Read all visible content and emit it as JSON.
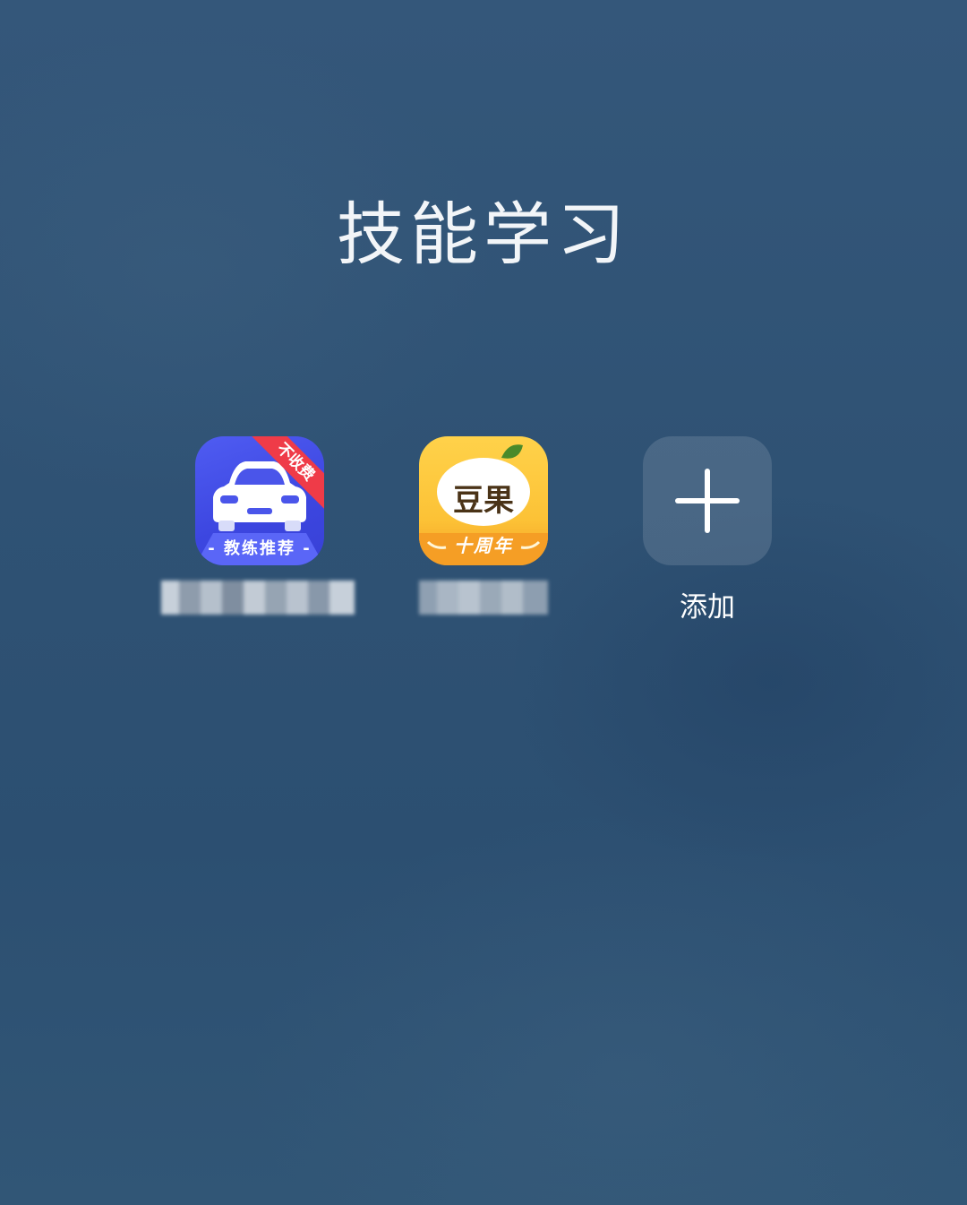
{
  "folder": {
    "title": "技能学习"
  },
  "apps": [
    {
      "id": "driving",
      "ribbon_text": "不收费",
      "banner_text": "- 教练推荐 -",
      "label_hidden": true
    },
    {
      "id": "douguo",
      "icon_text": "豆果",
      "banner_text": "十周年",
      "label_hidden": true
    },
    {
      "id": "add",
      "label": "添加"
    }
  ],
  "colors": {
    "background": "#2f5274",
    "driving_icon": "#3c46e0",
    "driving_ribbon": "#ef3b48",
    "douguo_icon": "#fcc236",
    "douguo_banner": "#f59e25"
  },
  "icons": [
    "car-icon",
    "douguo-icon",
    "plus-icon"
  ]
}
